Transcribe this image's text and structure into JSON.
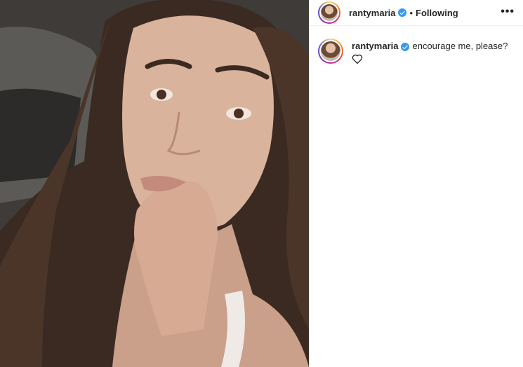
{
  "post": {
    "username": "rantymaria",
    "follow_status": "Following",
    "separator": "•",
    "more_label": "•••",
    "caption": "encourage me, please?",
    "icons": {
      "verified": "verified-badge-icon",
      "more": "more-options-icon",
      "like": "heart-icon"
    },
    "colors": {
      "verified": "#3897f0",
      "text": "#262626",
      "divider": "#efefef"
    }
  }
}
